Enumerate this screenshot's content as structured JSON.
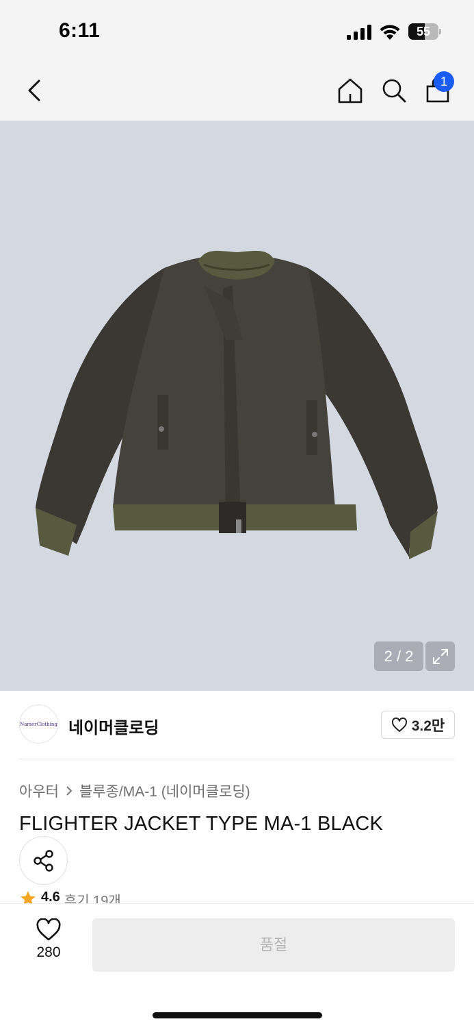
{
  "status_bar": {
    "time": "6:11",
    "battery": "55",
    "battery_level": 0.55,
    "icons": [
      "signal-icon",
      "wifi-icon",
      "battery-icon"
    ]
  },
  "nav": {
    "icons": [
      "back-icon",
      "home-icon",
      "search-icon",
      "cart-icon"
    ],
    "cart_badge": "1",
    "badge_color": "#1a5cf5"
  },
  "gallery": {
    "counter": "2 / 2",
    "background": "#d4d8e1",
    "expand_icon": "expand-icon"
  },
  "brand": {
    "logo_text": "NamerClothing",
    "name": "네이머클로딩",
    "likes": "3.2만"
  },
  "breadcrumb": {
    "category": "아우터",
    "subcategory": "블루종/MA-1 (네이머클로딩)"
  },
  "product": {
    "title": "FLIGHTER JACKET TYPE MA-1 BLACK",
    "rating": "4.6",
    "reviews": "후기 19개"
  },
  "bottom_bar": {
    "wish_count": "280",
    "action_label": "품절"
  },
  "colors": {
    "accent": "#1a5cf5",
    "star": "#f5a623"
  }
}
